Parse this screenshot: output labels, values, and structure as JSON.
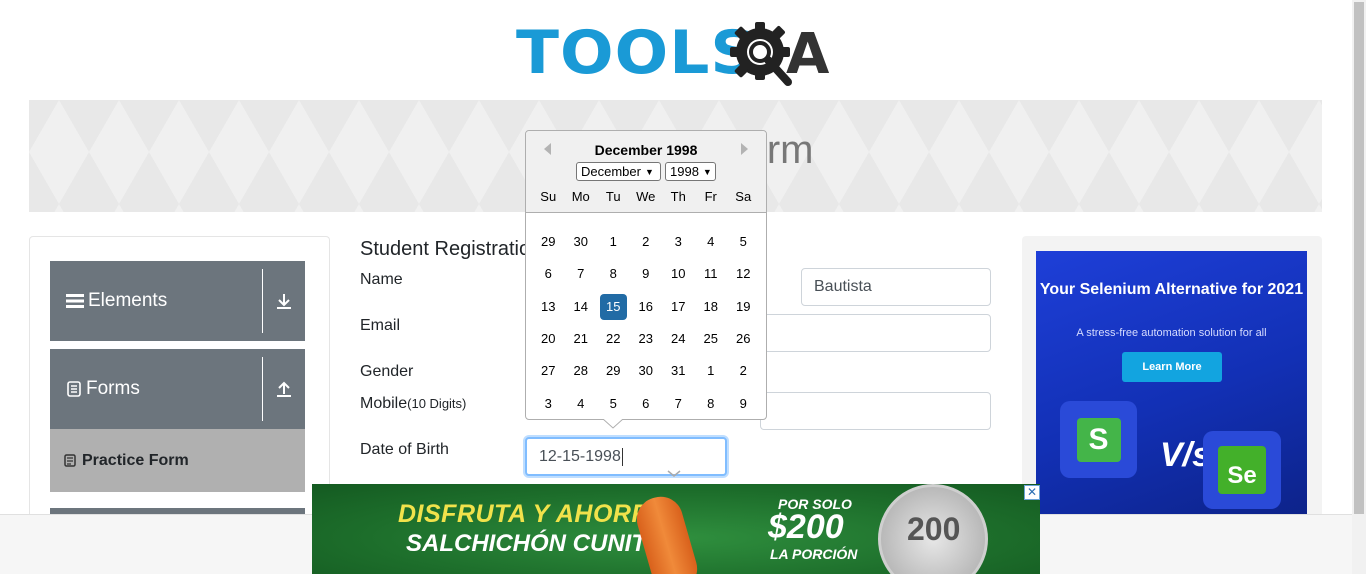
{
  "header": {
    "logo_text": "TOOLS",
    "logo_suffix": "A"
  },
  "banner": {
    "title": "Practice Form"
  },
  "sidebar": {
    "groups": [
      {
        "label": "Elements",
        "icon": "hamburger-icon",
        "arrow": "download-arrow-icon"
      },
      {
        "label": "Forms",
        "icon": "document-icon",
        "arrow": "upload-arrow-icon"
      }
    ],
    "active_item": {
      "label": "Practice Form",
      "icon": "form-icon"
    }
  },
  "form": {
    "title": "Student Registration Form",
    "name_label": "Name",
    "last_name_value": "Bautista",
    "email_label": "Email",
    "gender_label": "Gender",
    "mobile_label": "Mobile",
    "mobile_hint": "(10 Digits)",
    "dob_label": "Date of Birth",
    "dob_value": "12-15-1998"
  },
  "datepicker": {
    "header": "December 1998",
    "month_select": "December",
    "year_select": "1998",
    "day_names": [
      "Su",
      "Mo",
      "Tu",
      "We",
      "Th",
      "Fr",
      "Sa"
    ],
    "weeks": [
      [
        "29",
        "30",
        "1",
        "2",
        "3",
        "4",
        "5"
      ],
      [
        "6",
        "7",
        "8",
        "9",
        "10",
        "11",
        "12"
      ],
      [
        "13",
        "14",
        "15",
        "16",
        "17",
        "18",
        "19"
      ],
      [
        "20",
        "21",
        "22",
        "23",
        "24",
        "25",
        "26"
      ],
      [
        "27",
        "28",
        "29",
        "30",
        "31",
        "1",
        "2"
      ],
      [
        "3",
        "4",
        "5",
        "6",
        "7",
        "8",
        "9"
      ]
    ],
    "selected_day": "15",
    "selected_color": "#216ba5"
  },
  "side_ad": {
    "title": "Your Selenium Alternative for 2021",
    "subtitle": "A stress-free automation solution for all",
    "button": "Learn More",
    "vs_text": "V/s",
    "tile_left": "S",
    "tile_right": "Se"
  },
  "bottom_ad": {
    "headline1": "DISFRUTA Y AHORRA",
    "headline2": "SALCHICHÓN CUNIT",
    "price_pre": "POR SOLO",
    "price": "$200",
    "price_post": "LA PORCIÓN",
    "coin_value": "200",
    "close": "✕"
  },
  "colors": {
    "brand_blue": "#1a9ad6",
    "sidebar_gray": "#6c757d",
    "focus_border": "#80bdff"
  }
}
